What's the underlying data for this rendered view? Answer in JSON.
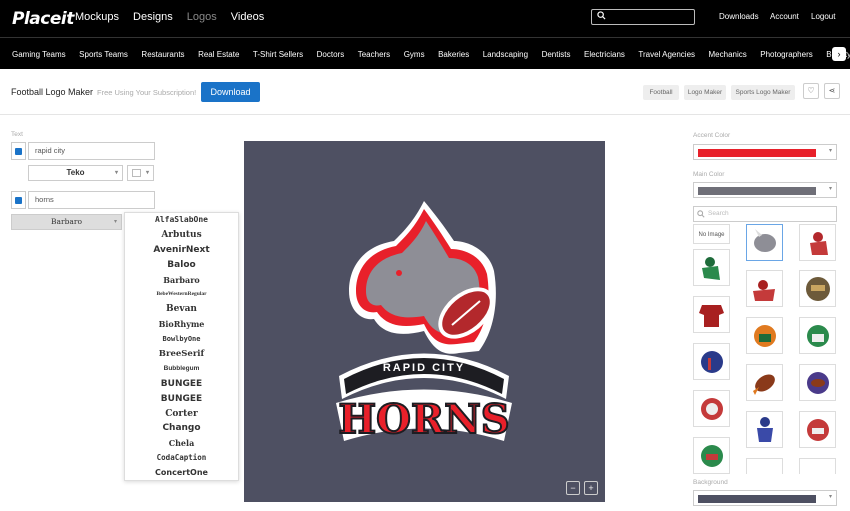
{
  "brand": {
    "logo": "Placeit"
  },
  "topnav": {
    "items": [
      "Mockups",
      "Designs",
      "Logos",
      "Videos"
    ],
    "active": "Logos"
  },
  "header_right": {
    "downloads": "Downloads",
    "account": "Account",
    "logout": "Logout"
  },
  "categories": [
    "Gaming Teams",
    "Sports Teams",
    "Restaurants",
    "Real Estate",
    "T-Shirt Sellers",
    "Doctors",
    "Teachers",
    "Gyms",
    "Bakeries",
    "Landscaping",
    "Dentists",
    "Electricians",
    "Travel Agencies",
    "Mechanics",
    "Photographers",
    "Beauty Salons"
  ],
  "page": {
    "title": "Football Logo Maker",
    "subtitle": "Free Using Your Subscription!",
    "download_label": "Download",
    "tags": [
      "Football",
      "Logo Maker",
      "Sports Logo Maker"
    ]
  },
  "editor": {
    "text_label": "Text",
    "text1": {
      "checked": true,
      "value": "rapid city"
    },
    "font1": "Teko",
    "text2": {
      "checked": true,
      "value": "horns"
    },
    "font2": "Barbaro",
    "font_options": [
      "AlfaSlabOne",
      "Arbutus",
      "AvenirNext",
      "Baloo",
      "Barbaro",
      "BebeWesternRegular",
      "Bevan",
      "BioRhyme",
      "BowlbyOne",
      "BreeSerif",
      "Bubblegum",
      "BUNGEE",
      "BUNGEE",
      "Corter",
      "Chango",
      "Chela",
      "CodaCaption",
      "ConcertOne"
    ]
  },
  "logo_art": {
    "line1": "RAPID CITY",
    "line2": "HORNS"
  },
  "zoom": {
    "out": "−",
    "in": "+"
  },
  "right_panel": {
    "accent_label": "Accent Color",
    "accent_color": "#e8202a",
    "main_label": "Main Color",
    "main_color": "#6f6f78",
    "search_placeholder": "Search",
    "no_image": "No Image",
    "background_label": "Background",
    "background_color": "#4e5062"
  }
}
